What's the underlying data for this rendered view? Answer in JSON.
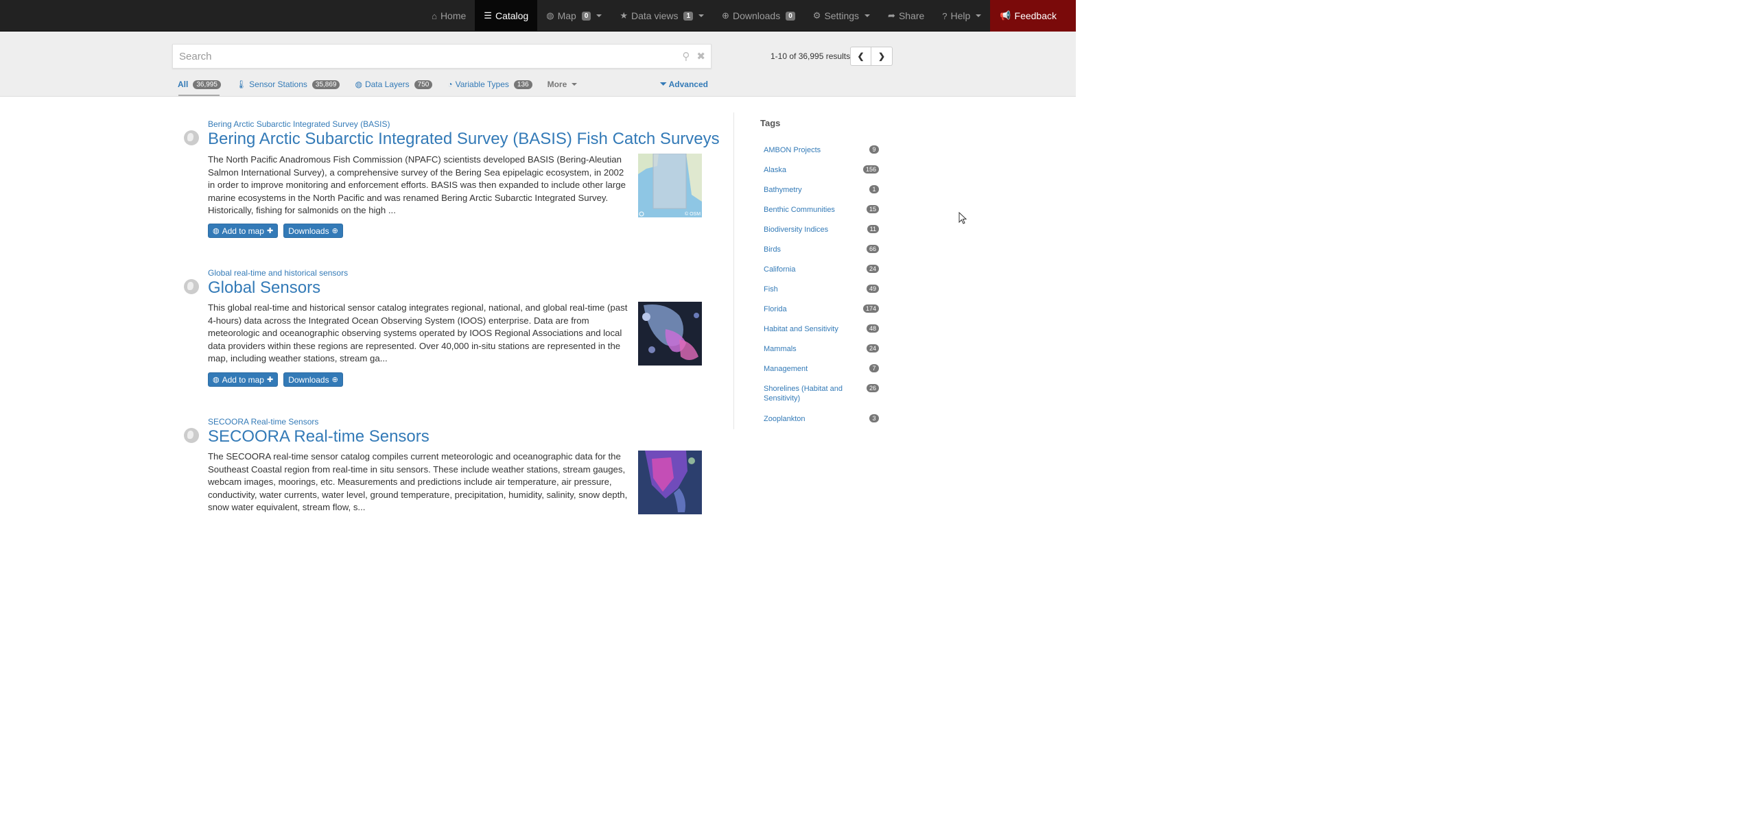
{
  "nav": {
    "home": "Home",
    "catalog": "Catalog",
    "map": "Map",
    "map_count": "0",
    "data_views": "Data views",
    "data_views_count": "1",
    "downloads": "Downloads",
    "downloads_count": "0",
    "settings": "Settings",
    "share": "Share",
    "help": "Help",
    "feedback": "Feedback"
  },
  "search": {
    "placeholder": "Search",
    "results_text": "1-10 of 36,995 results"
  },
  "tabs": [
    {
      "label": "All",
      "count": "36,995"
    },
    {
      "label": "Sensor Stations",
      "count": "35,869"
    },
    {
      "label": "Data Layers",
      "count": "750"
    },
    {
      "label": "Variable Types",
      "count": "136"
    },
    {
      "label": "More"
    }
  ],
  "advanced_label": "Advanced",
  "results": [
    {
      "subtitle": "Bering Arctic Subarctic Integrated Survey (BASIS)",
      "title": "Bering Arctic Subarctic Integrated Survey (BASIS) Fish Catch Surveys",
      "description": "The North Pacific Anadromous Fish Commission (NPAFC) scientists developed BASIS (Bering-Aleutian Salmon International Survey), a comprehensive survey of the Bering Sea epipelagic ecosystem, in 2002 in order to improve monitoring and enforcement efforts. BASIS was then expanded to include other large marine ecosystems in the North Pacific and was renamed Bering Arctic Subarctic Integrated Survey. Historically, fishing for salmonids on the high ...",
      "thumb_credit": "© OSM",
      "add_to_map": "Add to map",
      "downloads": "Downloads"
    },
    {
      "subtitle": "Global real-time and historical sensors",
      "title": "Global Sensors",
      "description": "This global real-time and historical sensor catalog integrates regional, national, and global real-time (past 4-hours) data across the Integrated Ocean Observing System (IOOS) enterprise. Data are from meteorologic and oceanographic observing systems operated by IOOS Regional Associations and local data providers within these regions are represented. Over 40,000 in-situ stations are represented in the map, including weather stations, stream ga...",
      "add_to_map": "Add to map",
      "downloads": "Downloads"
    },
    {
      "subtitle": "SECOORA Real-time Sensors",
      "title": "SECOORA Real-time Sensors",
      "description": "The SECOORA real-time sensor catalog compiles current meteorologic and oceanographic data for the Southeast Coastal region from real-time in situ sensors. These include weather stations, stream gauges, webcam images, moorings, etc. Measurements and predictions include air temperature, air pressure, conductivity, water currents, water level, ground temperature, precipitation, humidity, salinity, snow depth, snow water equivalent, stream flow, s..."
    }
  ],
  "tags": {
    "heading": "Tags",
    "items": [
      {
        "label": "AMBON Projects",
        "count": "9"
      },
      {
        "label": "Alaska",
        "count": "156"
      },
      {
        "label": "Bathymetry",
        "count": "1"
      },
      {
        "label": "Benthic Communities",
        "count": "15"
      },
      {
        "label": "Biodiversity Indices",
        "count": "11"
      },
      {
        "label": "Birds",
        "count": "66"
      },
      {
        "label": "California",
        "count": "24"
      },
      {
        "label": "Fish",
        "count": "49"
      },
      {
        "label": "Florida",
        "count": "174"
      },
      {
        "label": "Habitat and Sensitivity",
        "count": "48"
      },
      {
        "label": "Mammals",
        "count": "24"
      },
      {
        "label": "Management",
        "count": "7"
      },
      {
        "label": "Shorelines (Habitat and Sensitivity)",
        "count": "26"
      },
      {
        "label": "Zooplankton",
        "count": "3"
      }
    ]
  },
  "colors": {
    "navbar": "#222222",
    "link": "#337ab7",
    "feedback": "#7a0a0a"
  }
}
